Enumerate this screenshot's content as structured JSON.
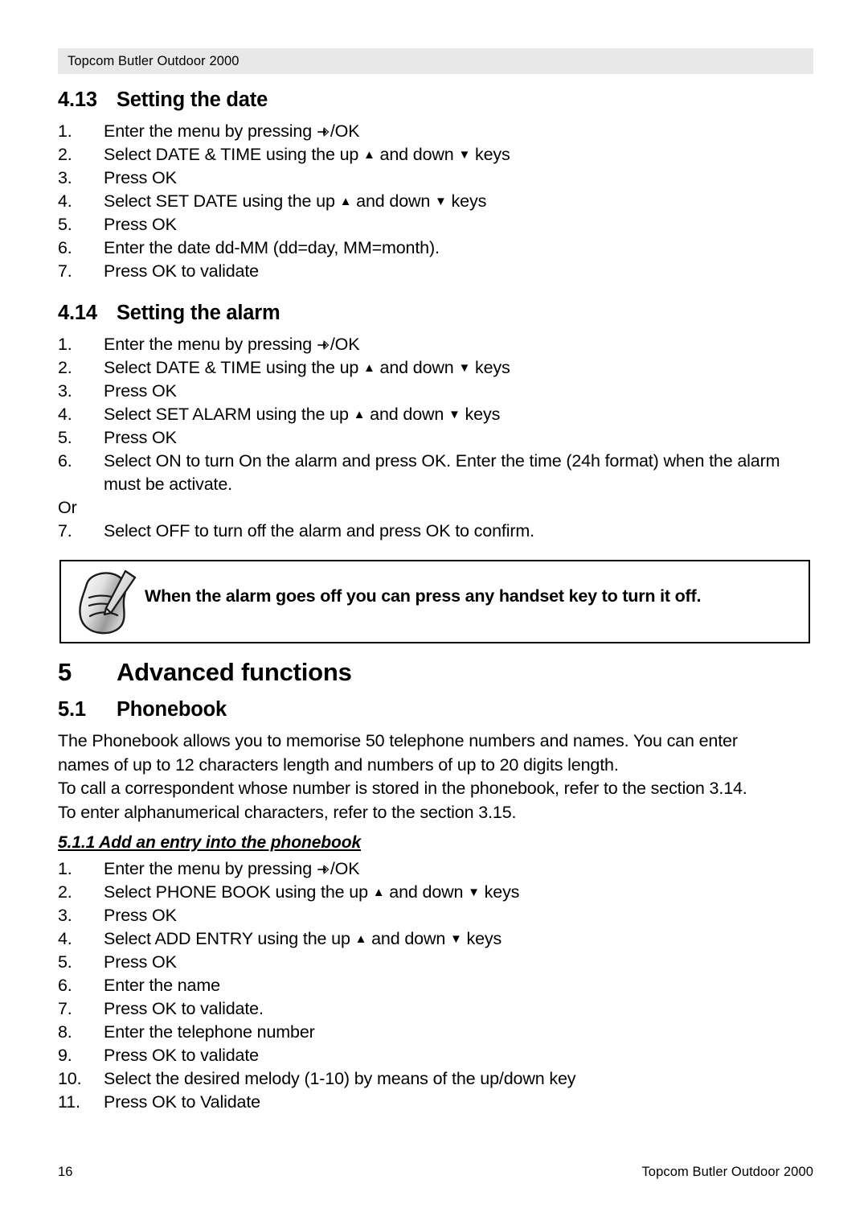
{
  "document": {
    "header_text": "Topcom Butler Outdoor 2000",
    "footer_page_number": "16",
    "footer_text": "Topcom Butler Outdoor 2000"
  },
  "sections": {
    "setting_date": {
      "number": "4.13",
      "title": "Setting the date",
      "steps": [
        {
          "idx": "1.",
          "pre": "Enter the menu by pressing ",
          "icon": "menu-ok-key-icon",
          "post": "/OK"
        },
        {
          "idx": "2.",
          "pre": "Select DATE & TIME using the up ",
          "up": "▲",
          "mid": " and down ",
          "down": "▼",
          "post": " keys"
        },
        {
          "idx": "3.",
          "pre": "Press OK"
        },
        {
          "idx": "4.",
          "pre": "Select SET DATE using the up ",
          "up": "▲",
          "mid": " and down ",
          "down": "▼",
          "post": " keys"
        },
        {
          "idx": "5.",
          "pre": "Press OK"
        },
        {
          "idx": "6.",
          "pre": "Enter the date dd-MM (dd=day, MM=month)."
        },
        {
          "idx": "7.",
          "pre": "Press OK to validate"
        }
      ]
    },
    "setting_alarm": {
      "number": "4.14",
      "title": "Setting the alarm",
      "steps": [
        {
          "idx": "1.",
          "pre": "Enter the menu by pressing ",
          "icon": "menu-ok-key-icon",
          "post": "/OK"
        },
        {
          "idx": "2.",
          "pre": "Select DATE & TIME using the up ",
          "up": "▲",
          "mid": " and down ",
          "down": "▼",
          "post": " keys"
        },
        {
          "idx": "3.",
          "pre": "Press OK"
        },
        {
          "idx": "4.",
          "pre": "Select SET ALARM using the up ",
          "up": "▲",
          "mid": " and down ",
          "down": "▼",
          "post": " keys"
        },
        {
          "idx": "5.",
          "pre": "Press OK"
        },
        {
          "idx": "6.",
          "pre": "Select ON to turn On the alarm and press OK.  Enter the time (24h format) when the alarm must be activate."
        }
      ],
      "or_label": "Or",
      "last_step": {
        "idx": "7.",
        "pre": "Select OFF to turn off the alarm and press OK to confirm."
      },
      "note": {
        "icon": "note-pencil-icon",
        "text": "When the alarm goes off you can press any handset key to turn it off."
      }
    },
    "advanced_functions": {
      "number": "5",
      "title": "Advanced functions"
    },
    "phonebook": {
      "number": "5.1",
      "title": "Phonebook",
      "paragraph_lines": [
        "The Phonebook allows you to memorise 50 telephone numbers and names. You can enter",
        "names of up to 12 characters length and numbers of up to 20 digits length.",
        "To call a correspondent whose number is stored in the phonebook, refer to the section 3.14.",
        "To enter alphanumerical characters, refer to the section 3.15."
      ]
    },
    "add_entry": {
      "heading": "5.1.1 Add an entry into the phonebook",
      "steps": [
        {
          "idx": "1.",
          "pre": "Enter the menu by pressing ",
          "icon": "menu-ok-key-icon",
          "post": "/OK"
        },
        {
          "idx": "2.",
          "pre": "Select PHONE BOOK using the up ",
          "up": "▲",
          "mid": " and down ",
          "down": "▼",
          "post": " keys"
        },
        {
          "idx": "3.",
          "pre": "Press OK"
        },
        {
          "idx": "4.",
          "pre": "Select ADD ENTRY using the up ",
          "up": "▲",
          "mid": " and down ",
          "down": "▼",
          "post": " keys"
        },
        {
          "idx": "5.",
          "pre": "Press OK"
        },
        {
          "idx": "6.",
          "pre": "Enter the name"
        },
        {
          "idx": "7.",
          "pre": "Press OK to validate."
        },
        {
          "idx": "8.",
          "pre": "Enter the telephone number"
        },
        {
          "idx": "9.",
          "pre": "Press OK to validate"
        },
        {
          "idx": "10.",
          "pre": "Select the desired melody (1-10) by means of the up/down key"
        },
        {
          "idx": "11.",
          "pre": "Press OK to Validate"
        }
      ]
    }
  },
  "colors": {
    "header_band": "#e8e8e8",
    "text": "#000000",
    "note_border": "#000000"
  }
}
